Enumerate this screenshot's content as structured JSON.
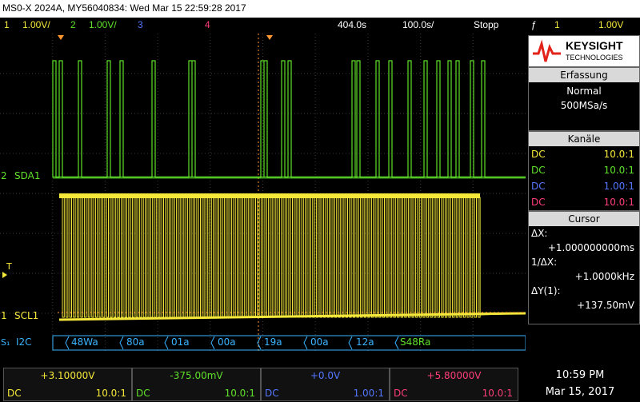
{
  "title": "MS0-X 2024A, MY56040834: Wed Mar 15 22:59:28 2017",
  "status": {
    "ch1_num": "1",
    "ch1_scale": "1.00V/",
    "ch2_num": "2",
    "ch2_scale": "1.00V/",
    "ch3_num": "3",
    "ch4_num": "4",
    "timebase": "404.0s",
    "delay": "100.0s/",
    "run_state": "Stopp",
    "trig_icon": "ƒ",
    "trig_ch": "1",
    "trig_level": "1.00V"
  },
  "colors": {
    "ch1": "#f5e83a",
    "ch2": "#5fe02a",
    "ch3": "#5577ff",
    "ch4": "#ff3e7a",
    "serial": "#3ab4ff",
    "marker": "#ff9830"
  },
  "scope": {
    "sda_label": "SDA1",
    "scl_label": "SCL1",
    "sda_marker": "2",
    "scl_marker": "1",
    "trig_marker": "T",
    "i2c_marker": "S₁",
    "i2c_label": "I2C",
    "decode": [
      "48Wa",
      "80a",
      "01a",
      "00a",
      "19a",
      "00a",
      "12a",
      "S48Ra"
    ]
  },
  "brand": {
    "name": "KEYSIGHT",
    "sub": "TECHNOLOGIES"
  },
  "acquisition": {
    "header": "Erfassung",
    "mode": "Normal",
    "rate": "500MSa/s"
  },
  "channels": {
    "header": "Kanäle",
    "rows": [
      {
        "coupling": "DC",
        "probe": "10.0:1"
      },
      {
        "coupling": "DC",
        "probe": "10.0:1"
      },
      {
        "coupling": "DC",
        "probe": "1.00:1"
      },
      {
        "coupling": "DC",
        "probe": "10.0:1"
      }
    ]
  },
  "cursor": {
    "header": "Cursor",
    "dx_label": "ΔX:",
    "dx_value": "+1.000000000ms",
    "inv_label": "1/ΔX:",
    "inv_value": "+1.0000kHz",
    "dy_label": "ΔY(1):",
    "dy_value": "+137.50mV"
  },
  "bottom": [
    {
      "offset": "+3.10000V",
      "coupling": "DC",
      "probe": "10.0:1"
    },
    {
      "offset": "-375.00mV",
      "coupling": "DC",
      "probe": "10.0:1"
    },
    {
      "offset": "+0.0V",
      "coupling": "DC",
      "probe": "1.00:1"
    },
    {
      "offset": "+5.80000V",
      "coupling": "DC",
      "probe": "10.0:1"
    }
  ],
  "clock": {
    "time": "10:59 PM",
    "date": "Mar 15, 2017"
  }
}
